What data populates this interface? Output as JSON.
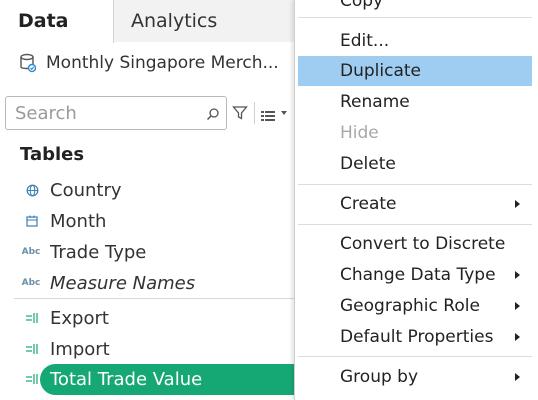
{
  "tabs": {
    "data": "Data",
    "analytics": "Analytics"
  },
  "datasource": {
    "name": "Monthly Singapore Merch..."
  },
  "search": {
    "placeholder": "Search"
  },
  "tables": {
    "title": "Tables",
    "dimensions": [
      {
        "label": "Country",
        "icon": "globe-icon"
      },
      {
        "label": "Month",
        "icon": "calendar-icon"
      },
      {
        "label": "Trade Type",
        "icon": "abc-string-icon"
      },
      {
        "label": "Measure Names",
        "icon": "abc-string-icon"
      }
    ],
    "measures": [
      {
        "label": "Export",
        "icon": "measure-icon"
      },
      {
        "label": "Import",
        "icon": "measure-icon"
      },
      {
        "label": "Total Trade Value",
        "icon": "measure-icon"
      }
    ]
  },
  "context_menu": {
    "copy": "Copy",
    "edit": "Edit...",
    "duplicate": "Duplicate",
    "rename": "Rename",
    "hide": "Hide",
    "delete": "Delete",
    "create": "Create",
    "convert_to_discrete": "Convert to Discrete",
    "change_data_type": "Change Data Type",
    "geographic_role": "Geographic Role",
    "default_properties": "Default Properties",
    "group_by": "Group by"
  },
  "colors": {
    "selected_pill": "#16a874",
    "menu_highlight": "#9fcdf2",
    "icon_blue": "#6b8fa8"
  }
}
